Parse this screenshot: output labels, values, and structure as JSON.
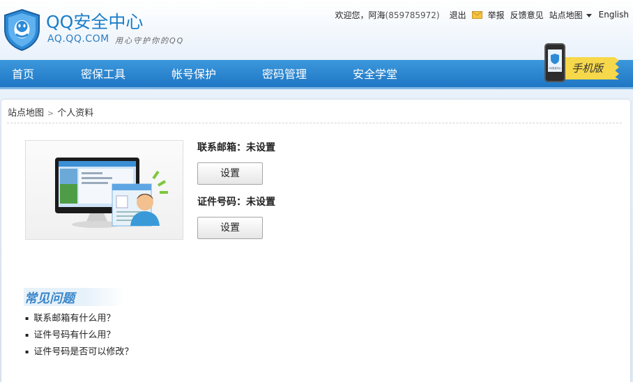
{
  "header": {
    "logo_title": "QQ安全中心",
    "logo_domain": "AQ.QQ.COM",
    "logo_slogan": "用心守护你的QQ",
    "welcome": "欢迎您，阿海",
    "user_id": "(859785972)",
    "logout": "退出",
    "report": "举报",
    "feedback": "反馈意见",
    "sitemap": "站点地图",
    "language": "English"
  },
  "nav": {
    "items": [
      "首页",
      "密保工具",
      "帐号保护",
      "密码管理",
      "安全学堂"
    ],
    "mobile_label": "手机版",
    "mobile_screen_text": "QQ安全中心"
  },
  "breadcrumb": {
    "root": "站点地图",
    "current": "个人资料"
  },
  "profile": {
    "email_label": "联系邮箱：",
    "email_value": "未设置",
    "email_button": "设置",
    "id_label": "证件号码：",
    "id_value": "未设置",
    "id_button": "设置"
  },
  "faq": {
    "title": "常见问题",
    "items": [
      "联系邮箱有什么用？",
      "证件号码有什么用？",
      "证件号码是否可以修改？"
    ]
  },
  "colors": {
    "nav_blue": "#1f76c4",
    "brand_blue": "#1c7ec8",
    "tag_yellow": "#f7d84a"
  }
}
